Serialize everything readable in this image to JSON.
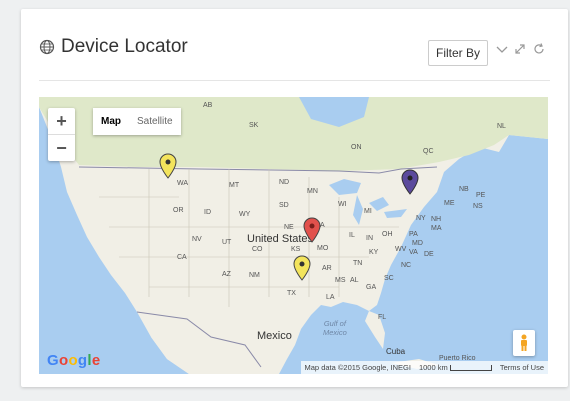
{
  "widget": {
    "title": "Device Locator",
    "title_icon": "globe-icon",
    "filter_label": "Filter By",
    "icons": [
      "chevron-down-icon",
      "expand-icon",
      "refresh-icon"
    ]
  },
  "map": {
    "zoom_in": "+",
    "zoom_out": "−",
    "type_map": "Map",
    "type_satellite": "Satellite",
    "selected_type": "Map",
    "brand": "Google",
    "attribution": "Map data ©2015 Google, INEGI",
    "scale_label": "1000 km",
    "terms": "Terms of Use",
    "labels": {
      "ab": "AB",
      "sk": "SK",
      "nl": "NL",
      "on": "ON",
      "qc": "QC",
      "wa": "WA",
      "mt": "MT",
      "nd": "ND",
      "mn": "MN",
      "or": "OR",
      "id": "ID",
      "wy": "WY",
      "sd": "SD",
      "wi": "WI",
      "mi": "MI",
      "ne": "NE",
      "ia": "IA",
      "nv": "NV",
      "ut": "UT",
      "co": "CO",
      "ks": "KS",
      "mo": "MO",
      "il": "IL",
      "in": "IN",
      "oh": "OH",
      "pa": "PA",
      "ny": "NY",
      "nb": "NB",
      "pe": "PE",
      "ns": "NS",
      "me": "ME",
      "nh": "NH",
      "ma": "MA",
      "md": "MD",
      "de": "DE",
      "wv": "WV",
      "ky": "KY",
      "va": "VA",
      "ca": "CA",
      "az": "AZ",
      "nm": "NM",
      "ok": "OK",
      "ar": "AR",
      "tn": "TN",
      "nc": "NC",
      "tx": "TX",
      "ms": "MS",
      "al": "AL",
      "ga": "GA",
      "sc": "SC",
      "la": "LA",
      "fl": "FL",
      "country_us": "United States",
      "country_mx": "Mexico",
      "gulf": "Gulf of\nMexico",
      "cuba": "Cuba",
      "pr": "Puerto Rico"
    },
    "markers": [
      {
        "name": "marker-seattle",
        "color": "#f3e45c"
      },
      {
        "name": "marker-quebec",
        "color": "#5b4a9c"
      },
      {
        "name": "marker-kansas",
        "color": "#e2514c"
      },
      {
        "name": "marker-oklahoma",
        "color": "#f3e45c"
      }
    ]
  }
}
